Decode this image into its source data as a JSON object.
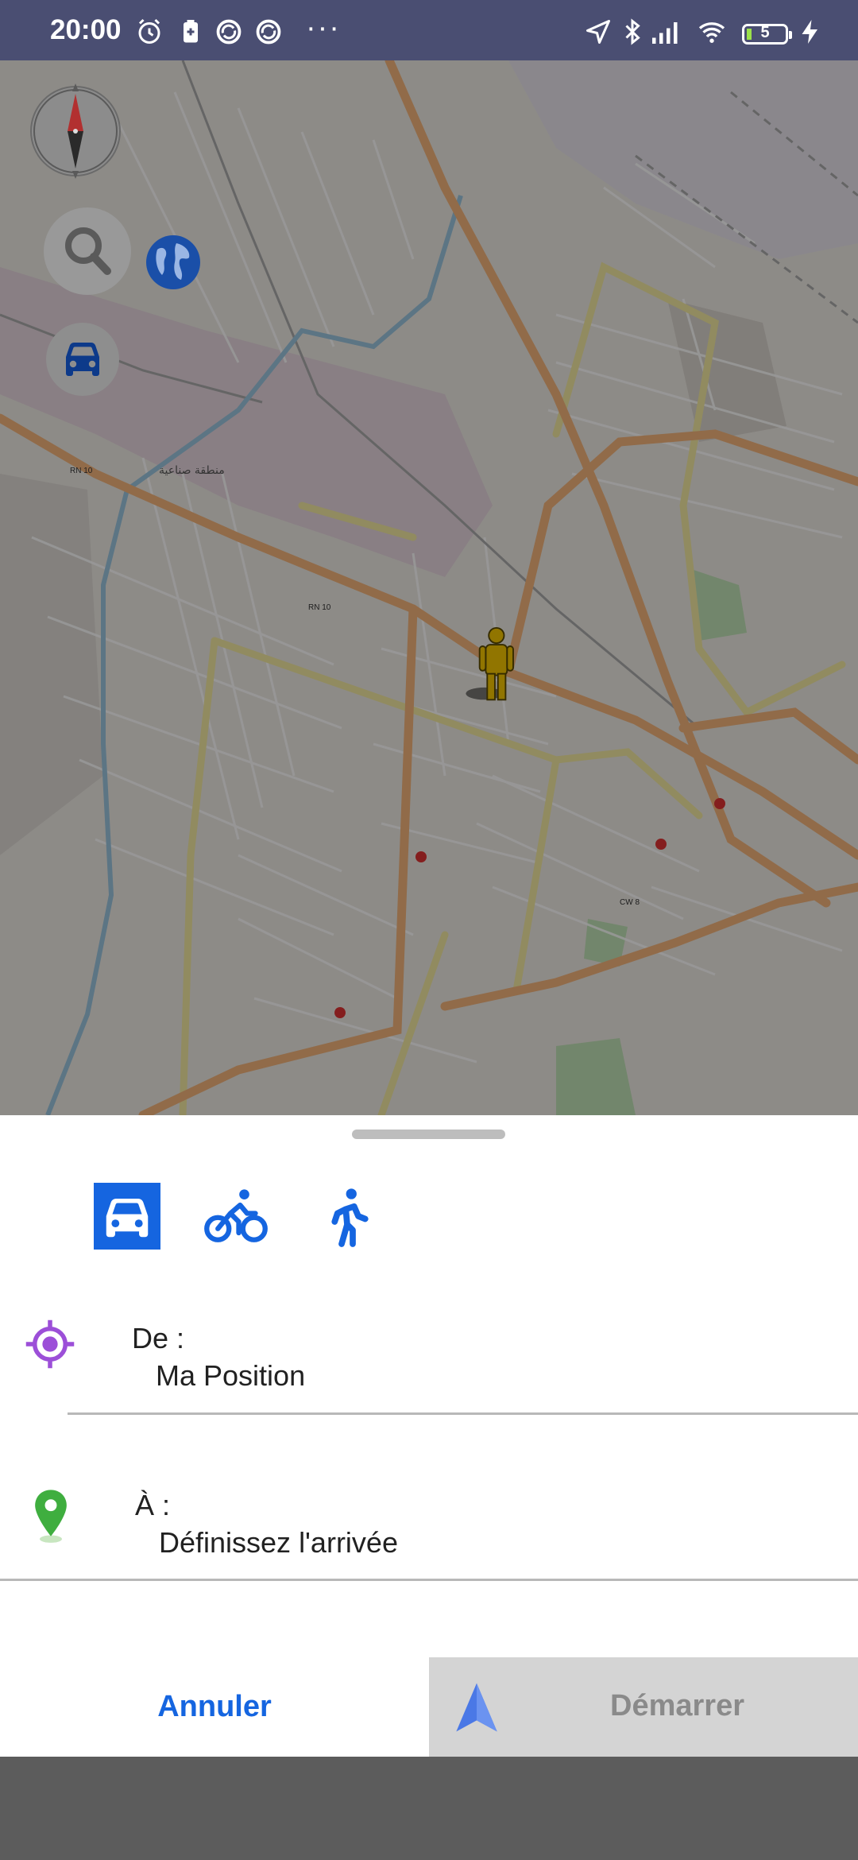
{
  "status_bar": {
    "time": "20:00",
    "icons": [
      "alarm-icon",
      "battery-saver-icon",
      "sync-icon",
      "sync-icon",
      "more-dots-icon",
      "location-arrow-icon",
      "bluetooth-icon",
      "signal-icon",
      "wifi-icon",
      "battery-icon",
      "charging-icon"
    ],
    "more": "···",
    "battery_level": "5"
  },
  "map": {
    "controls": [
      "compass-icon",
      "search-icon",
      "globe-icon",
      "car-icon"
    ],
    "labels": {
      "rn10_a": "RN 10",
      "rn10_b": "RN 10",
      "cw8": "CW 8",
      "zone": "منطقة صناعية"
    },
    "user_marker": "pedestrian-icon"
  },
  "colors": {
    "status_bar": "#4a4e72",
    "accent": "#1565e0",
    "start_button_bg": "#d4d4d4",
    "origin_icon": "#9c4fd8",
    "destination_icon": "#3fae3f"
  },
  "route_sheet": {
    "modes": [
      {
        "name": "car",
        "icon": "car-icon",
        "selected": true
      },
      {
        "name": "bike",
        "icon": "bicycle-icon",
        "selected": false
      },
      {
        "name": "walk",
        "icon": "pedestrian-icon",
        "selected": false
      }
    ],
    "from": {
      "label": "De :",
      "value": "Ma Position",
      "icon": "my-location-icon"
    },
    "to": {
      "label": "À :",
      "value": "Définissez l'arrivée",
      "icon": "map-pin-icon"
    },
    "cancel_label": "Annuler",
    "start_label": "Démarrer"
  }
}
